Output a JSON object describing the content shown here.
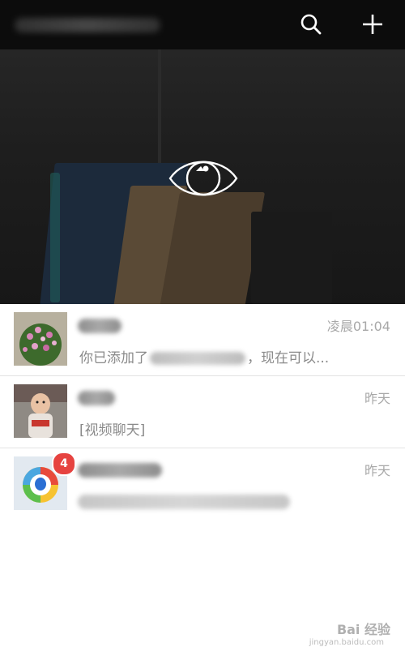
{
  "toolbar": {
    "icons": {
      "search": "search-icon",
      "add": "plus-icon"
    }
  },
  "chats": [
    {
      "time": "凌晨01:04",
      "message_before": "你已添加了",
      "message_after": "，现在可以...",
      "avatar": "flower-photo"
    },
    {
      "time": "昨天",
      "message": "[视频聊天]",
      "avatar": "baby-photo"
    },
    {
      "time": "昨天",
      "badge": "4",
      "avatar": "qq-browser-logo"
    }
  ],
  "watermark": {
    "brand": "Bai 经验",
    "url": "jingyan.baidu.com"
  },
  "colors": {
    "topbar": "#0c0c0c",
    "badge": "#e64340",
    "time": "#a8a8a8",
    "message": "#8a8a8a"
  }
}
